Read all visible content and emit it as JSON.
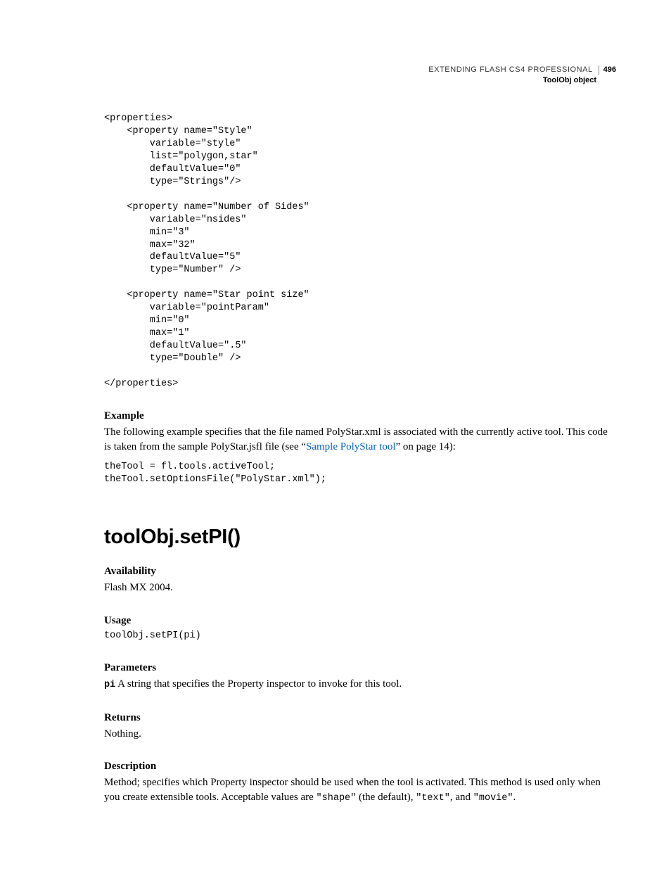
{
  "header": {
    "book_title": "EXTENDING FLASH CS4 PROFESSIONAL",
    "page_number": "496",
    "section": "ToolObj object"
  },
  "code_block_xml": "<properties>\n    <property name=\"Style\"\n        variable=\"style\"\n        list=\"polygon,star\"\n        defaultValue=\"0\"\n        type=\"Strings\"/>\n\n    <property name=\"Number of Sides\"\n        variable=\"nsides\"\n        min=\"3\"\n        max=\"32\"\n        defaultValue=\"5\"\n        type=\"Number\" />\n\n    <property name=\"Star point size\"\n        variable=\"pointParam\"\n        min=\"0\"\n        max=\"1\"\n        defaultValue=\".5\"\n        type=\"Double\" />\n\n</properties>",
  "example": {
    "heading": "Example",
    "para_pre": "The following example specifies that the file named PolyStar.xml is associated with the currently active tool. This code is taken from the sample PolyStar.jsfl file (see “",
    "link_text": "Sample PolyStar tool",
    "para_post": "” on page 14):",
    "code": "theTool = fl.tools.activeTool;\ntheTool.setOptionsFile(\"PolyStar.xml\");"
  },
  "method": {
    "title": "toolObj.setPI()",
    "availability": {
      "heading": "Availability",
      "text": "Flash MX 2004."
    },
    "usage": {
      "heading": "Usage",
      "code": "toolObj.setPI(pi)"
    },
    "parameters": {
      "heading": "Parameters",
      "param": "pi",
      "text": "  A string that specifies the Property inspector to invoke for this tool."
    },
    "returns": {
      "heading": "Returns",
      "text": "Nothing."
    },
    "description": {
      "heading": "Description",
      "pre": "Method; specifies which Property inspector should be used when the tool is activated. This method is used only when you create extensible tools. Acceptable values are ",
      "v1": "\"shape\"",
      "mid1": " (the default), ",
      "v2": "\"text\"",
      "mid2": ", and ",
      "v3": "\"movie\"",
      "post": "."
    }
  }
}
